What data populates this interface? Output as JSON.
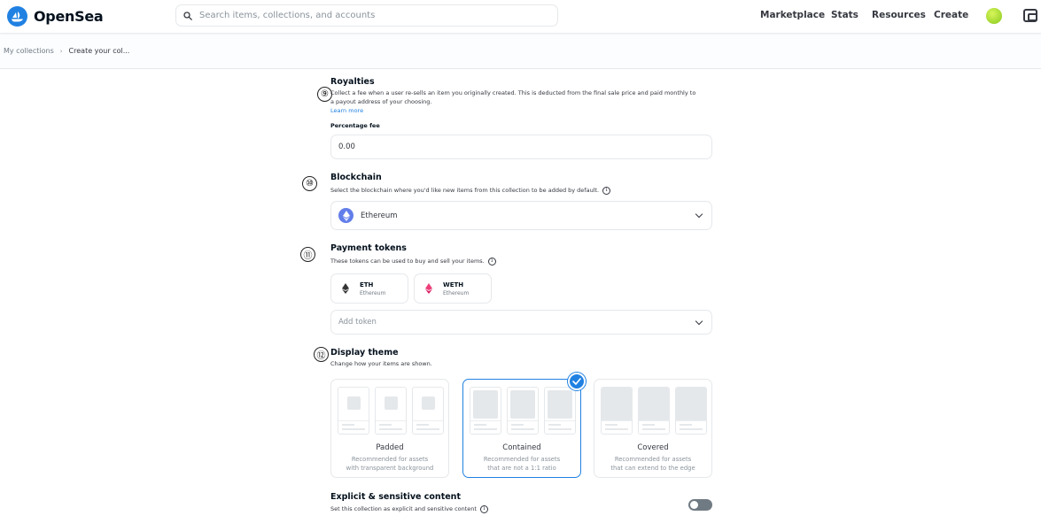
{
  "header": {
    "brand": "OpenSea",
    "search_placeholder": "Search items, collections, and accounts",
    "nav": [
      "Marketplace",
      "Stats",
      "Resources",
      "Create"
    ]
  },
  "breadcrumb": {
    "items": [
      "My collections",
      "Create your col..."
    ],
    "separator": "›"
  },
  "royalties": {
    "marker": "⑨",
    "title": "Royalties",
    "desc_line1": "Collect a fee when a user re-sells an item you originally created. This is deducted from the final sale price and paid monthly to",
    "desc_line2": "a payout address of your choosing.",
    "learn_more": "Learn more",
    "fee_label": "Percentage fee",
    "fee_value": "0.00"
  },
  "blockchain": {
    "marker": "⑩",
    "title": "Blockchain",
    "desc": "Select the blockchain where you'd like new items from this collection to be added by default.",
    "selected": "Ethereum"
  },
  "payment_tokens": {
    "marker": "⑪",
    "title": "Payment tokens",
    "desc": "These tokens can be used to buy and sell your items.",
    "tokens": [
      {
        "symbol": "ETH",
        "network": "Ethereum"
      },
      {
        "symbol": "WETH",
        "network": "Ethereum"
      }
    ],
    "add_placeholder": "Add token"
  },
  "display_theme": {
    "marker": "⑫",
    "title": "Display theme",
    "desc": "Change how your items are shown.",
    "options": [
      {
        "title": "Padded",
        "desc_line1": "Recommended for assets",
        "desc_line2": "with transparent background"
      },
      {
        "title": "Contained",
        "desc_line1": "Recommended for assets",
        "desc_line2": "that are not a 1:1 ratio"
      },
      {
        "title": "Covered",
        "desc_line1": "Recommended for assets",
        "desc_line2": "that can extend to the edge"
      }
    ],
    "selected": "Contained"
  },
  "explicit": {
    "title": "Explicit & sensitive content",
    "desc": "Set this collection as explicit and sensitive content",
    "enabled": false
  },
  "colors": {
    "accent": "#2081e2",
    "text": "#04111d",
    "muted": "#8a939b",
    "toggle_off": "#707a83",
    "eth_badge": "#627eea",
    "weth_badge": "#ec407a"
  },
  "icons": [
    "opensea-logo-icon",
    "search-icon",
    "avatar",
    "wallet-icon",
    "info-icon",
    "ethereum-icon",
    "weth-icon",
    "chevron-down-icon",
    "check-icon"
  ]
}
